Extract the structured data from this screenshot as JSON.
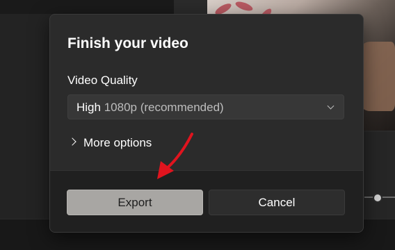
{
  "dialog": {
    "title": "Finish your video",
    "quality_label": "Video Quality",
    "quality_select": {
      "value_main": "High",
      "value_detail": "1080p (recommended)"
    },
    "more_options_label": "More options",
    "export_label": "Export",
    "cancel_label": "Cancel"
  },
  "icons": {
    "dropdown": "chevron-down-icon",
    "expand": "chevron-right-icon",
    "annotation": "red-arrow-pointer"
  },
  "colors": {
    "dialog_bg": "#2b2b2b",
    "footer_bg": "#202020",
    "export_bg": "#a8a6a3",
    "arrow": "#e0141e"
  }
}
